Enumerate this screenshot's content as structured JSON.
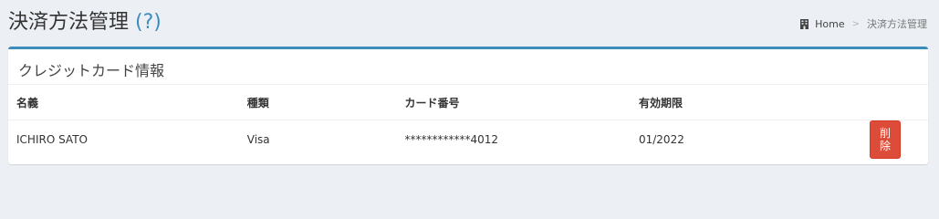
{
  "header": {
    "title": "決済方法管理",
    "help_open": "(",
    "help_link": "?",
    "help_close": ")"
  },
  "breadcrumb": {
    "icon": "building-icon",
    "home": "Home",
    "separator": ">",
    "current": "決済方法管理"
  },
  "box": {
    "title": "クレジットカード情報",
    "accent_color": "#3c8dbc"
  },
  "table": {
    "headers": [
      "名義",
      "種類",
      "カード番号",
      "有効期限"
    ],
    "rows": [
      {
        "name": "ICHIRO SATO",
        "type": "Visa",
        "number": "************4012",
        "expiry": "01/2022",
        "action": "削除"
      }
    ]
  },
  "colors": {
    "background": "#ecf0f5",
    "link": "#3c8dbc",
    "danger": "#dd4b39"
  }
}
